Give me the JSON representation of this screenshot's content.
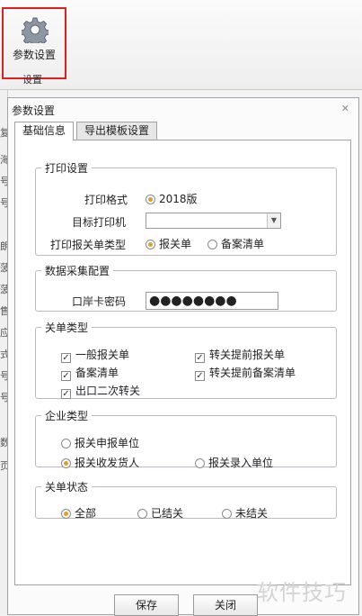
{
  "ribbon": {
    "button_label": "参数设置",
    "group_label": "设置",
    "button_icon": "gear-icon"
  },
  "left_strip_chars": [
    "复",
    "海",
    "号",
    "号",
    "朗",
    "菠",
    "菠",
    "售",
    "应",
    "式",
    "号",
    "号",
    "数",
    "页"
  ],
  "dialog": {
    "title": "参数设置",
    "close_glyph": "✕",
    "tabs": [
      {
        "label": "基础信息",
        "active": true
      },
      {
        "label": "导出模板设置",
        "active": false
      }
    ],
    "print_settings": {
      "legend": "打印设置",
      "format_label": "打印格式",
      "format_option": "2018版",
      "printer_label": "目标打印机",
      "printer_value": "",
      "type_label": "打印报关单类型",
      "type_options": [
        {
          "label": "报关单",
          "selected": true
        },
        {
          "label": "备案清单",
          "selected": false
        }
      ]
    },
    "data_collection": {
      "legend": "数据采集配置",
      "password_label": "口岸卡密码",
      "password_value": "●●●●●●●●"
    },
    "doc_type": {
      "legend": "关单类型",
      "checks": [
        {
          "label": "一般报关单",
          "checked": true
        },
        {
          "label": "转关提前报关单",
          "checked": true
        },
        {
          "label": "备案清单",
          "checked": true
        },
        {
          "label": "转关提前备案清单",
          "checked": true
        },
        {
          "label": "出口二次转关",
          "checked": true
        }
      ]
    },
    "company_type": {
      "legend": "企业类型",
      "options": [
        {
          "label": "报关申报单位",
          "selected": false
        },
        {
          "label": "报关收发货人",
          "selected": true
        },
        {
          "label": "报关录入单位",
          "selected": false
        }
      ]
    },
    "doc_status": {
      "legend": "关单状态",
      "options": [
        {
          "label": "全部",
          "selected": true
        },
        {
          "label": "已结关",
          "selected": false
        },
        {
          "label": "未结关",
          "selected": false
        }
      ]
    },
    "buttons": {
      "save": "保存",
      "close": "关闭"
    }
  },
  "watermark": "软件技巧",
  "colors": {
    "highlight_border": "#e02020",
    "radio_selected": "#e0a020"
  }
}
